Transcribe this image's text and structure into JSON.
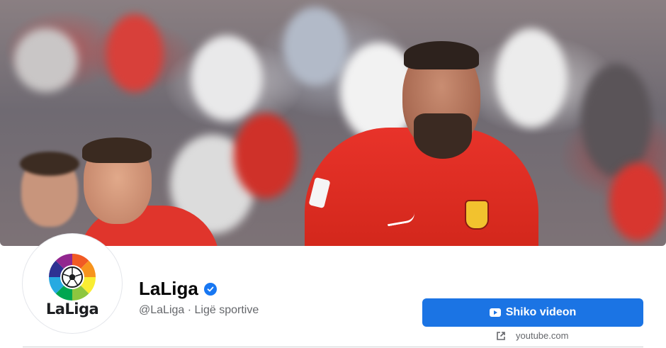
{
  "page": {
    "name": "LaLiga",
    "handle_category": "@LaLiga · Ligë sportive",
    "avatar_logo_text": "LaLiga"
  },
  "cta": {
    "label": "Shiko videon",
    "icon": "youtube-icon",
    "link_text": "youtube.com",
    "link_icon": "external-link-icon"
  },
  "colors": {
    "cta_background": "#1b74e4",
    "verified_badge": "#1877f2",
    "cover_shirt_red": "#e8332a"
  },
  "icons": {
    "verified": "verified-badge-icon"
  }
}
